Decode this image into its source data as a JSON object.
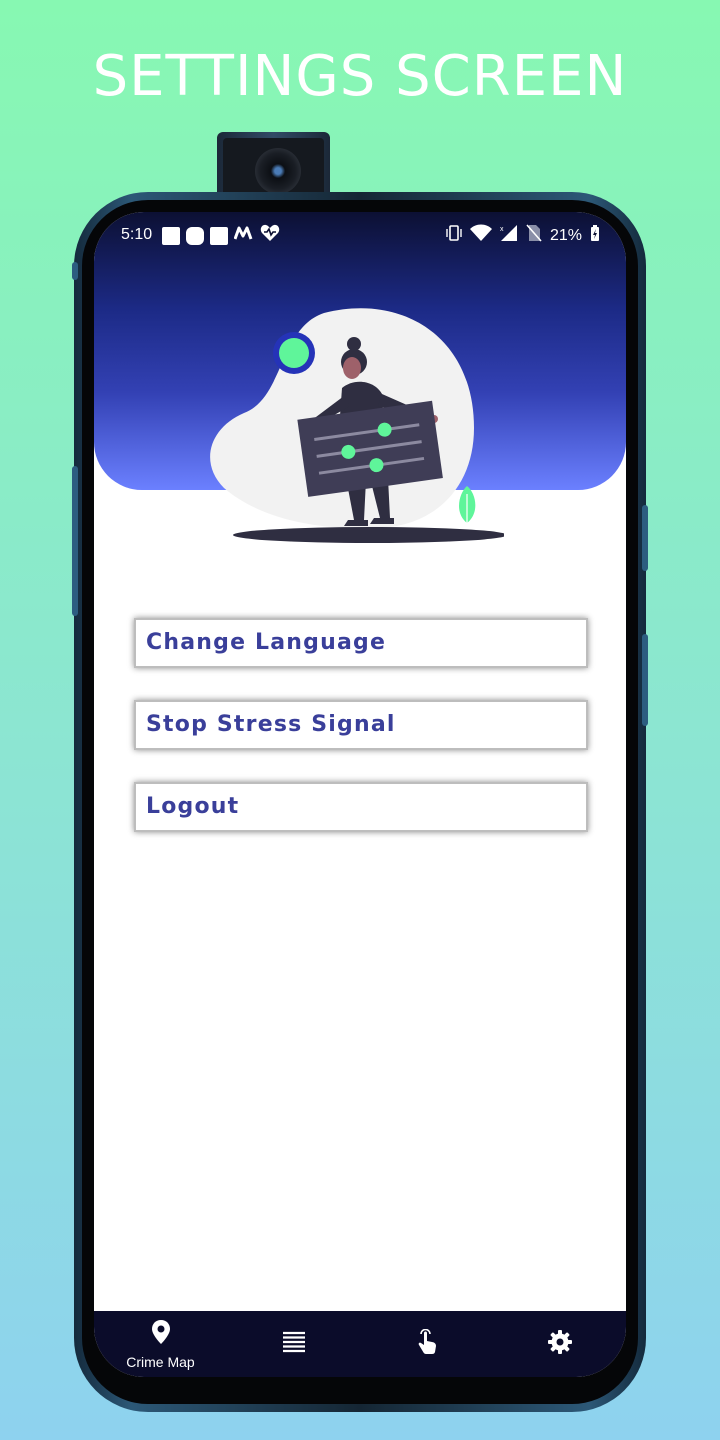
{
  "page_title": "SETTINGS SCREEN",
  "status_bar": {
    "time": "5:10",
    "battery": "21%",
    "notification_icons": [
      "square-icon",
      "rounded-square-icon",
      "square-icon",
      "m-logo-icon",
      "heart-pulse-icon"
    ],
    "system_icons": [
      "vibrate-icon",
      "wifi-icon",
      "signal-icon",
      "no-sim-icon",
      "battery-charging-icon"
    ]
  },
  "menu": [
    {
      "label": "Change Language"
    },
    {
      "label": "Stop Stress Signal"
    },
    {
      "label": "Logout"
    }
  ],
  "bottom_nav": {
    "items": [
      {
        "icon": "location-pin-icon",
        "label": "Crime Map"
      },
      {
        "icon": "list-icon",
        "label": ""
      },
      {
        "icon": "tap-hand-icon",
        "label": ""
      },
      {
        "icon": "gear-icon",
        "label": ""
      }
    ]
  },
  "colors": {
    "background_top": "#87f8b2",
    "background_bottom": "#8ed2ef",
    "header_dark": "#0c1033",
    "header_light": "#6b80ff",
    "accent_green": "#5ff59a",
    "button_text": "#3a3f9a",
    "navbar": "#0b0c2a"
  }
}
